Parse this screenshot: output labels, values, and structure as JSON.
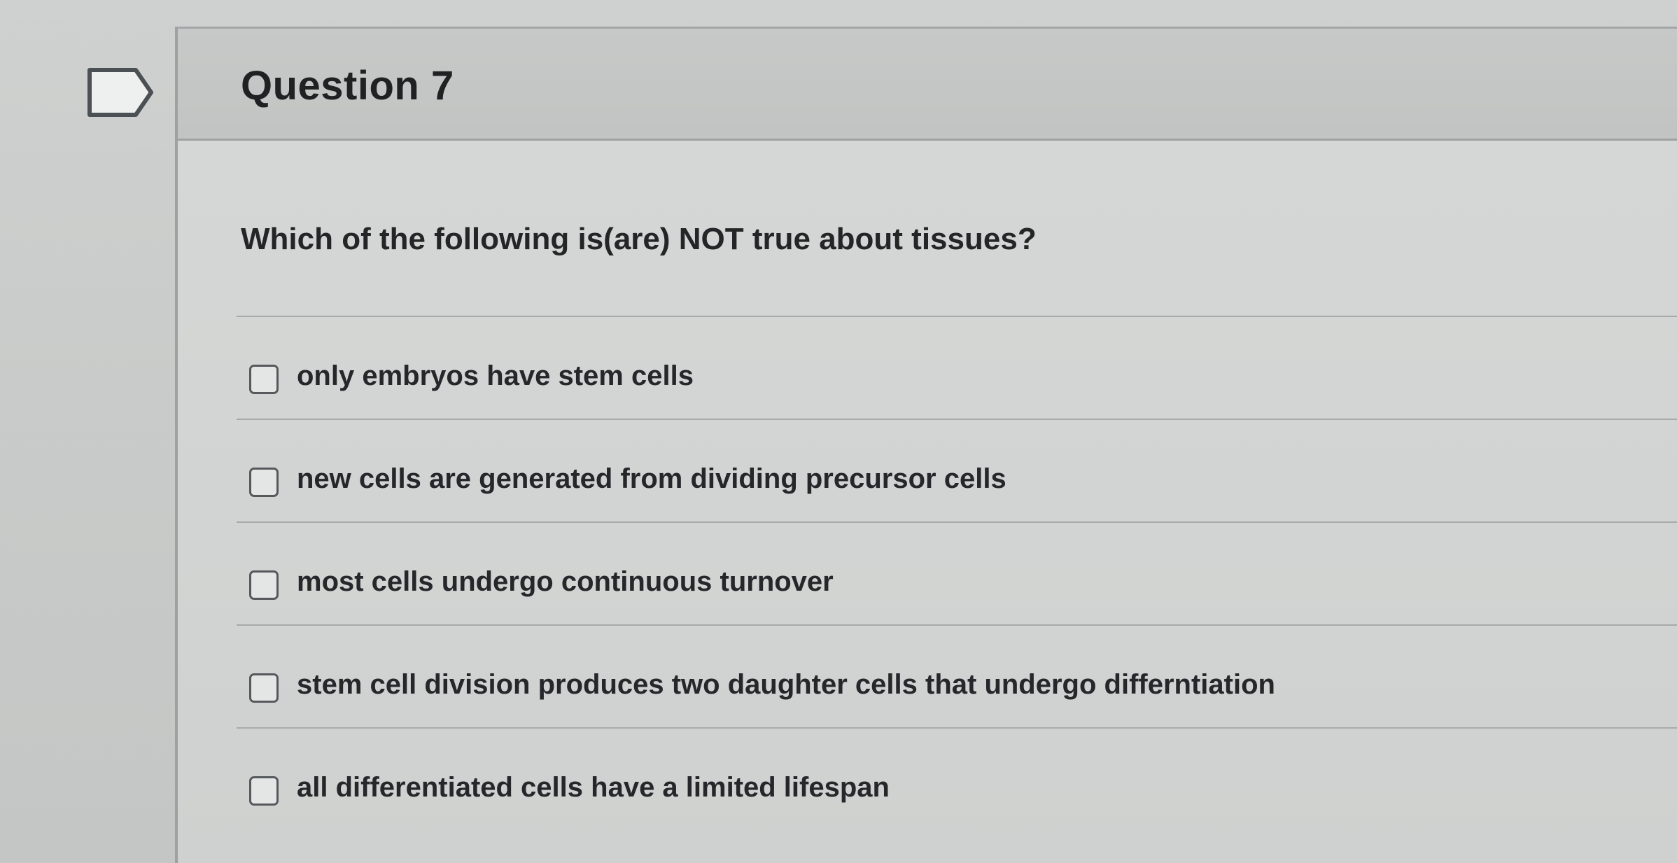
{
  "question": {
    "title": "Question 7",
    "prompt": "Which of the following is(are) NOT true about tissues?",
    "options": [
      {
        "label": "only embryos have stem cells",
        "checked": false
      },
      {
        "label": "new cells are generated from dividing precursor cells",
        "checked": false
      },
      {
        "label": "most cells undergo continuous turnover",
        "checked": false
      },
      {
        "label": "stem cell division produces two daughter cells that undergo differntiation",
        "checked": false
      },
      {
        "label": "all differentiated cells have a limited lifespan",
        "checked": false
      }
    ]
  },
  "icons": {
    "flag": "flag-icon",
    "checkbox": "checkbox-icon"
  },
  "colors": {
    "header_background": "#c4c6c5",
    "card_background": "#d3d5d4",
    "text": "#222426",
    "checkbox_border": "#55595c"
  }
}
